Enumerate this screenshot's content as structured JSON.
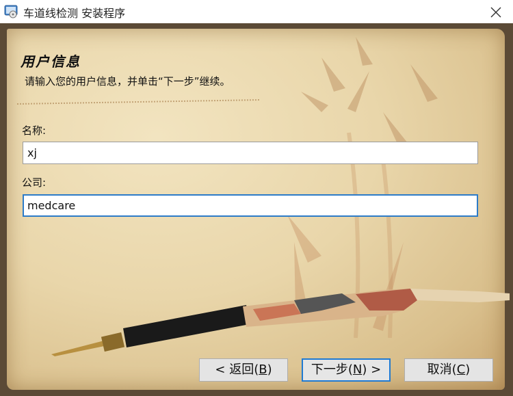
{
  "window": {
    "title": "车道线检测 安装程序",
    "icon": "installer-icon",
    "close_icon": "close-icon"
  },
  "page": {
    "heading": "用户信息",
    "instruction": "请输入您的用户信息，并单击“下一步”继续。"
  },
  "form": {
    "name_label": "名称:",
    "name_value": "xj",
    "company_label": "公司:",
    "company_value": "medcare"
  },
  "buttons": {
    "back_prefix": "< 返回(",
    "back_mnemonic": "B",
    "back_suffix": ")",
    "next_prefix": "下一步(",
    "next_mnemonic": "N",
    "next_suffix": ") >",
    "cancel_prefix": "取消(",
    "cancel_mnemonic": "C",
    "cancel_suffix": ")"
  },
  "colors": {
    "focus_border": "#2c7bc8",
    "paper": "#e9d6aa"
  }
}
